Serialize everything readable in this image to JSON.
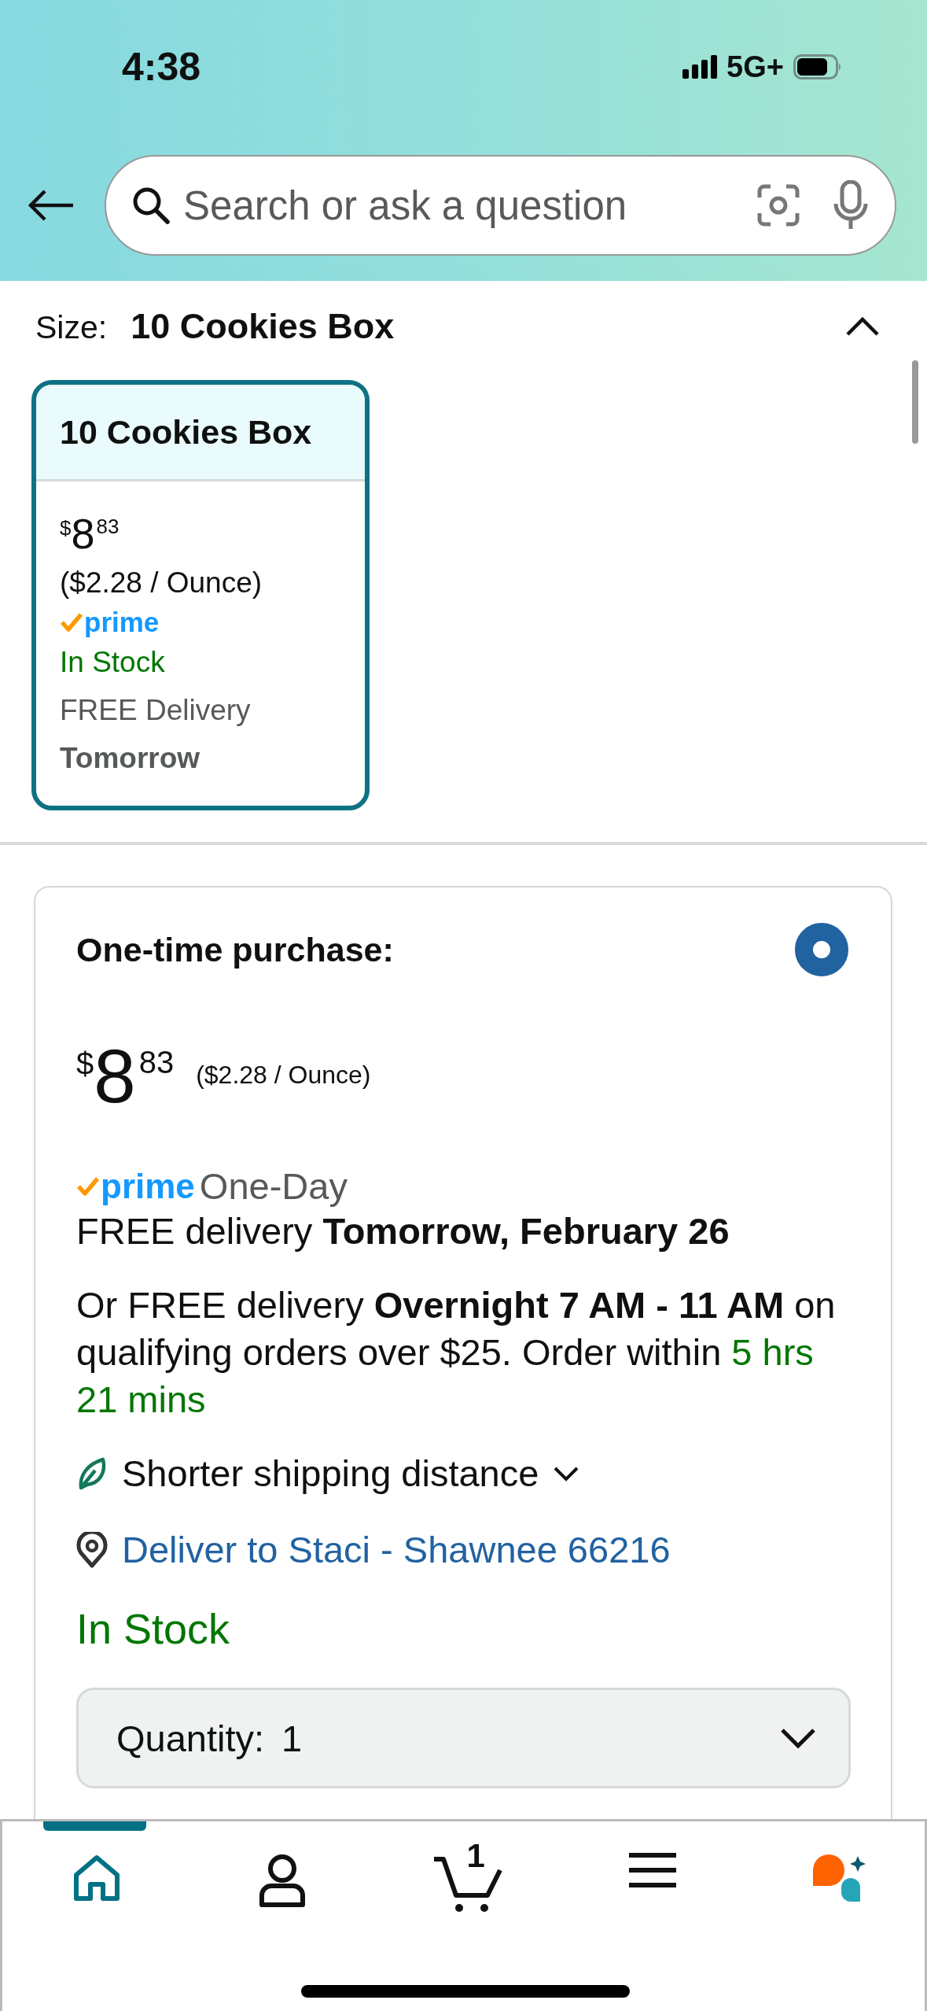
{
  "status_bar": {
    "time": "4:38",
    "network": "5G+"
  },
  "search": {
    "placeholder": "Search or ask a question"
  },
  "size_selector": {
    "label": "Size:",
    "value": "10 Cookies Box",
    "expanded": true,
    "options": [
      {
        "name": "10 Cookies Box",
        "selected": true,
        "price_symbol": "$",
        "price_whole": "8",
        "price_fraction": "83",
        "unit_price": "($2.28 / Ounce)",
        "prime": "prime",
        "availability": "In Stock",
        "delivery": "FREE Delivery",
        "delivery_day": "Tomorrow"
      }
    ]
  },
  "purchase_option": {
    "title": "One-time purchase:",
    "selected": true,
    "price_symbol": "$",
    "price_whole": "8",
    "price_fraction": "83",
    "unit_price": "($2.28 / Ounce)",
    "prime": "prime",
    "prime_label": "One-Day",
    "delivery": "FREE delivery **Tomorrow, February 26**",
    "alt_delivery": "Or FREE delivery **Overnight 7 AM - 11 AM** on qualifying orders over $25. Order within",
    "countdown": "5 hrs 21 mins",
    "eco": "Shorter shipping distance",
    "deliver_to": "Deliver to Staci - Shawnee 66216",
    "availability": "In Stock",
    "quantity": {
      "label": "Quantity:",
      "value": "1"
    }
  },
  "tab_bar": [
    {
      "kind": "home",
      "selected": true
    },
    {
      "kind": "account",
      "selected": false
    },
    {
      "kind": "cart",
      "selected": false,
      "count": "1"
    },
    {
      "kind": "menu",
      "selected": false
    },
    {
      "kind": "assistant",
      "selected": false
    }
  ]
}
